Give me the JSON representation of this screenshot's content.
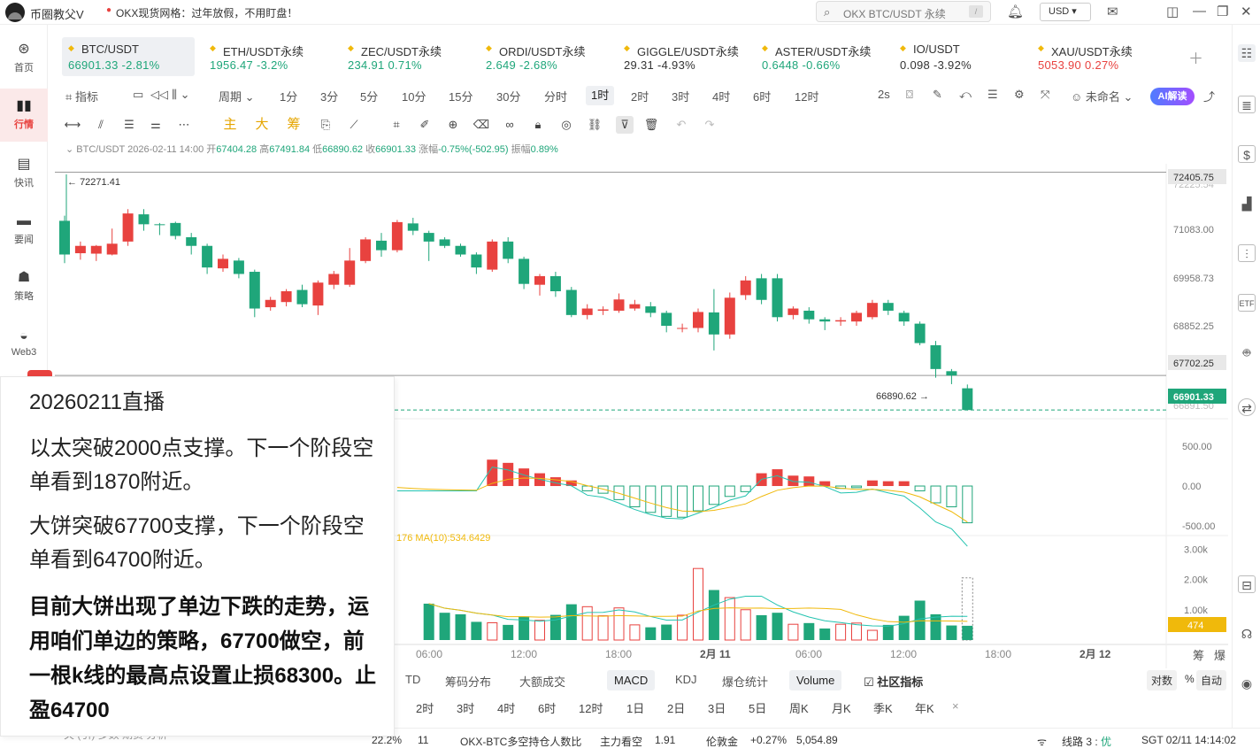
{
  "titlebar": {
    "app_name": "币圈教父V",
    "ticker_text": "OKX现货网格：过年放假，不用盯盘！",
    "search_text": "OKX BTC/USDT 永续",
    "search_shortcut": "/",
    "currency": "USD ▾"
  },
  "nav": [
    {
      "label": "首页",
      "icon": "home-icon"
    },
    {
      "label": "行情",
      "icon": "chart-bars-icon"
    },
    {
      "label": "快讯",
      "icon": "flash-news-icon"
    },
    {
      "label": "要闻",
      "icon": "document-icon"
    },
    {
      "label": "策略",
      "icon": "robot-icon"
    },
    {
      "label": "Web3",
      "icon": "web3-icon"
    }
  ],
  "tickers": [
    {
      "name": "BTC/USDT",
      "price": "66901.33",
      "change": "-2.81%",
      "color": "down"
    },
    {
      "name": "ETH/USDT永续",
      "price": "1956.47",
      "change": "-3.2%",
      "color": "down"
    },
    {
      "name": "ZEC/USDT永续",
      "price": "234.91",
      "change": "0.71%",
      "color": "down"
    },
    {
      "name": "ORDI/USDT永续",
      "price": "2.649",
      "change": "-2.68%",
      "color": "down"
    },
    {
      "name": "GIGGLE/USDT永续",
      "price": "29.31",
      "change": "-4.93%",
      "color": "neutral"
    },
    {
      "name": "ASTER/USDT永续",
      "price": "0.6448",
      "change": "-0.66%",
      "color": "down"
    },
    {
      "name": "IO/USDT",
      "price": "0.098",
      "change": "-3.92%",
      "color": "neutral"
    },
    {
      "name": "XAU/USDT永续",
      "price": "5053.90",
      "change": "0.27%",
      "color": "up"
    }
  ],
  "toolbar": {
    "indicator": "指标",
    "period": "周期",
    "intervals": [
      "1分",
      "3分",
      "5分",
      "10分",
      "15分",
      "30分",
      "分时",
      "1时",
      "2时",
      "3时",
      "4时",
      "6时",
      "12时"
    ],
    "selected_interval": "1时",
    "refresh": "2s",
    "layout_name": "未命名",
    "ai_label": "AI解读"
  },
  "drawtools": {
    "zhu": "主",
    "da": "大",
    "chou": "筹"
  },
  "ohlc": {
    "symbol": "BTC/USDT",
    "time": "2026-02-11 14:00",
    "open_label": "开",
    "open": "67404.28",
    "high_label": "高",
    "high": "67491.84",
    "low_label": "低",
    "low": "66890.62",
    "close_label": "收",
    "close": "66901.33",
    "chg_label": "涨幅",
    "chg": "-0.75%(-502.95)",
    "amp_label": "振幅",
    "amp": "0.89%"
  },
  "chart_data": {
    "type": "candlestick",
    "price_axis": {
      "ticks": [
        "71083.00",
        "69958.73",
        "68852.25"
      ],
      "range": [
        66700,
        72600
      ]
    },
    "price_labels": {
      "high_line": "72405.75",
      "support_line": "67702.25",
      "last": "66901.33",
      "clipped_top": "72225.54",
      "clipped_bottom": "66891.50"
    },
    "annotations": {
      "max": "72271.41",
      "min": "66890.62"
    },
    "candles": [
      [
        71280,
        70500,
        71400,
        70300
      ],
      [
        70530,
        70700,
        70800,
        70380
      ],
      [
        70520,
        70700,
        70720,
        70350
      ],
      [
        70500,
        70750,
        71100,
        70480
      ],
      [
        70800,
        71450,
        71550,
        70700
      ],
      [
        71430,
        71200,
        71550,
        71050
      ],
      [
        71200,
        71180,
        71230,
        70950
      ],
      [
        71230,
        70930,
        71260,
        70850
      ],
      [
        70900,
        70700,
        71000,
        70500
      ],
      [
        70700,
        70200,
        70750,
        70050
      ],
      [
        70180,
        70400,
        70500,
        70100
      ],
      [
        70360,
        70050,
        70420,
        69950
      ],
      [
        70100,
        69250,
        70150,
        69050
      ],
      [
        69280,
        69450,
        69520,
        69200
      ],
      [
        69400,
        69650,
        69700,
        69300
      ],
      [
        69680,
        69350,
        69800,
        69280
      ],
      [
        69320,
        69850,
        69900,
        69100
      ],
      [
        69800,
        70050,
        70120,
        69700
      ],
      [
        69800,
        70360,
        70650,
        69750
      ],
      [
        70350,
        70850,
        70900,
        70300
      ],
      [
        70820,
        70600,
        71000,
        70450
      ],
      [
        70600,
        71250,
        71300,
        70550
      ],
      [
        71220,
        71050,
        71350,
        70950
      ],
      [
        71000,
        70800,
        71050,
        70350
      ],
      [
        70850,
        70700,
        70900,
        70650
      ],
      [
        70700,
        70500,
        70750,
        70450
      ],
      [
        70500,
        70200,
        70550,
        70050
      ],
      [
        70150,
        70800,
        70850,
        70100
      ],
      [
        70800,
        70400,
        70900,
        70300
      ],
      [
        70400,
        69820,
        70450,
        69700
      ],
      [
        69800,
        70000,
        70050,
        69550
      ],
      [
        70000,
        69650,
        70100,
        69520
      ],
      [
        69680,
        69100,
        69750,
        69050
      ],
      [
        69100,
        69250,
        69350,
        69000
      ],
      [
        69200,
        69230,
        69300,
        69100
      ],
      [
        69200,
        69460,
        69600,
        69150
      ],
      [
        69250,
        69350,
        69450,
        69200
      ],
      [
        69300,
        69150,
        69400,
        69050
      ],
      [
        69150,
        68850,
        69200,
        68700
      ],
      [
        68800,
        68800,
        68900,
        68700
      ],
      [
        68800,
        69170,
        69250,
        68700
      ],
      [
        69160,
        68650,
        69700,
        68280
      ],
      [
        68650,
        69500,
        69620,
        68550
      ],
      [
        69560,
        69900,
        70000,
        69450
      ],
      [
        69950,
        69450,
        70050,
        69350
      ],
      [
        69950,
        69050,
        70050,
        68950
      ],
      [
        69100,
        69250,
        69300,
        69000
      ],
      [
        69200,
        69000,
        69280,
        68900
      ],
      [
        69000,
        68950,
        69050,
        68750
      ],
      [
        68950,
        68980,
        69050,
        68850
      ],
      [
        68950,
        69150,
        69200,
        68850
      ],
      [
        69050,
        69380,
        69450,
        69000
      ],
      [
        69380,
        69200,
        69450,
        69100
      ],
      [
        69150,
        68950,
        69200,
        68850
      ],
      [
        68900,
        68450,
        68950,
        68400
      ],
      [
        68400,
        67850,
        68500,
        67650
      ],
      [
        67800,
        67700,
        67850,
        67500
      ],
      [
        67404.28,
        66901.33,
        67491.84,
        66890.62
      ]
    ],
    "macd": {
      "label": "176  MA(10):534.6429",
      "ticks": [
        "500.00",
        "0.00",
        "-500.00"
      ],
      "hist": [
        0,
        0,
        0,
        0,
        0,
        0,
        0,
        0,
        0,
        0,
        0,
        0,
        0,
        0,
        0,
        0,
        0,
        0,
        0,
        0,
        0,
        0,
        0,
        0,
        330,
        290,
        220,
        160,
        110,
        70,
        -60,
        -90,
        -170,
        -260,
        -330,
        -380,
        -390,
        -310,
        -230,
        -130,
        -70,
        160,
        210,
        130,
        120,
        60,
        -30,
        -20,
        70,
        60,
        60,
        -60,
        -210,
        -260,
        -460
      ]
    },
    "volume": {
      "ticks": [
        "3.00k",
        "2.00k",
        "1.00k"
      ],
      "last": "474",
      "bars": [
        0,
        0,
        0,
        0,
        0,
        0,
        0,
        0,
        0,
        0,
        0,
        0,
        0,
        0,
        0,
        0,
        0,
        0,
        0,
        0,
        0,
        0,
        0,
        0,
        1200,
        900,
        850,
        600,
        570,
        500,
        780,
        650,
        830,
        1180,
        1100,
        800,
        1060,
        500,
        420,
        510,
        820,
        2360,
        1650,
        1400,
        1000,
        820,
        900,
        520,
        560,
        380,
        520,
        560,
        320,
        500,
        800,
        1300,
        850,
        480,
        470
      ]
    },
    "time_axis": [
      "06:00",
      "12:00",
      "18:00",
      "2月 11",
      "06:00",
      "12:00",
      "18:00",
      "2月 12"
    ],
    "corner": [
      "筹",
      "爆"
    ]
  },
  "indicator_tabs": [
    "TD",
    "筹码分布",
    "大额成交",
    "MACD",
    "KDJ",
    "爆仓统计",
    "Volume",
    "社区指标"
  ],
  "selected_indicators": [
    "MACD",
    "Volume"
  ],
  "scale": {
    "log": "对数",
    "pct": "%",
    "auto": "自动"
  },
  "timeframes": [
    "2时",
    "3时",
    "4时",
    "6时",
    "12时",
    "1日",
    "2日",
    "3日",
    "5日",
    "周K",
    "月K",
    "季K",
    "年K",
    "×"
  ],
  "statusbar": {
    "left": "关   (引)   多数   期货   分析",
    "mid_pct": "22.2%",
    "mid_val": "11",
    "ratio": "OKX-BTC多空持仓人数比",
    "ratio_tag": "主力看空",
    "ratio_val": "1.91",
    "gold": "伦敦金",
    "gold_chg": "+0.27%",
    "gold_val": "5,054.89",
    "line": "线路 3 : ",
    "line_q": "优",
    "time": "SGT 02/11 14:14:02"
  },
  "overlay": {
    "title": "20260211直播",
    "p1": "以太突破2000点支撑。下一个阶段空单看到1870附近。",
    "p2": "大饼突破67700支撑，下一个阶段空单看到64700附近。",
    "bold": "目前大饼出现了单边下跌的走势，运用咱们单边的策略，67700做空，前一根k线的最高点设置止损68300。止盈64700"
  },
  "colors": {
    "up": "#e8423f",
    "down": "#1fa67a",
    "accent": "#f0b90b",
    "macd_dif": "#23c3b0",
    "macd_dea": "#f0b90b"
  }
}
